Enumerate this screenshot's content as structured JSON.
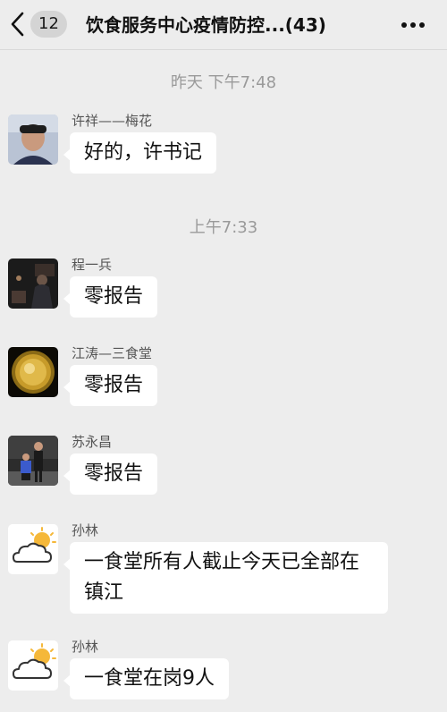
{
  "header": {
    "unread_count": "12",
    "title": "饮食服务中心疫情防控...(43)"
  },
  "timestamps": [
    "昨天 下午7:48",
    "上午7:33"
  ],
  "messages": [
    {
      "sender": "许祥——梅花",
      "text": "好的，许书记",
      "avatar": "person-photo"
    },
    {
      "sender": "程一兵",
      "text": "零报告",
      "avatar": "dark-photo"
    },
    {
      "sender": "江涛—三食堂",
      "text": "零报告",
      "avatar": "gold-plate-photo"
    },
    {
      "sender": "苏永昌",
      "text": "零报告",
      "avatar": "people-photo"
    },
    {
      "sender": "孙林",
      "text": "一食堂所有人截止今天已全部在镇江",
      "avatar": "sun-cloud"
    },
    {
      "sender": "孙林",
      "text": "一食堂在岗9人",
      "avatar": "sun-cloud"
    }
  ],
  "colors": {
    "background": "#ededed",
    "bubble": "#ffffff",
    "timestamp": "#9a9a9a"
  }
}
